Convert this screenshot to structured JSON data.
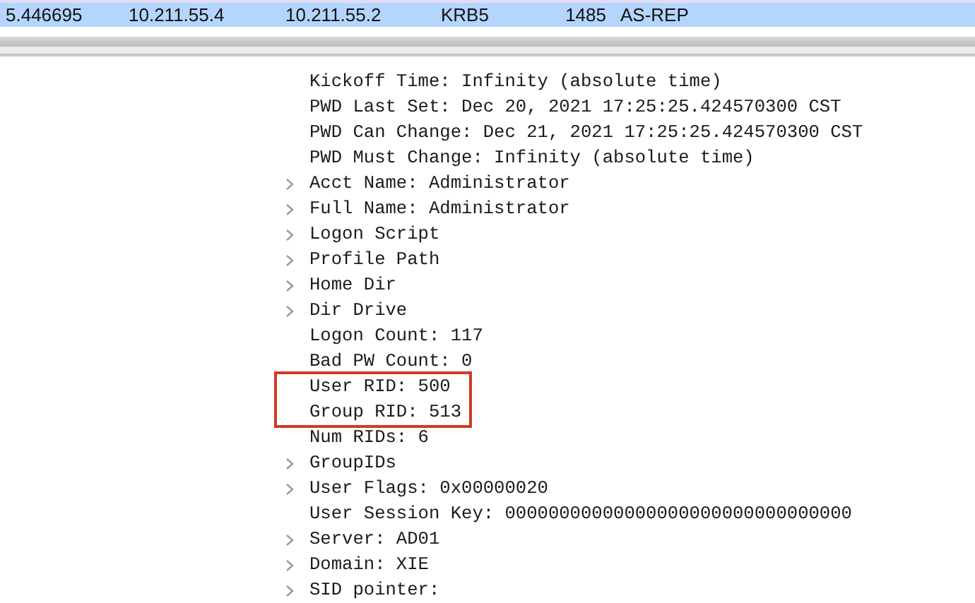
{
  "packet_row": {
    "selected": true,
    "cells": [
      "5.446695",
      "10.211.55.4",
      "10.211.55.2",
      "KRB5",
      "1485",
      "AS-REP"
    ]
  },
  "details": [
    {
      "text": "Kickoff Time: Infinity (absolute time)",
      "expandable": false,
      "highlighted": false
    },
    {
      "text": "PWD Last Set: Dec 20, 2021 17:25:25.424570300 CST",
      "expandable": false,
      "highlighted": false
    },
    {
      "text": "PWD Can Change: Dec 21, 2021 17:25:25.424570300 CST",
      "expandable": false,
      "highlighted": false
    },
    {
      "text": "PWD Must Change: Infinity (absolute time)",
      "expandable": false,
      "highlighted": false
    },
    {
      "text": "Acct Name: Administrator",
      "expandable": true,
      "highlighted": false
    },
    {
      "text": "Full Name: Administrator",
      "expandable": true,
      "highlighted": false
    },
    {
      "text": "Logon Script",
      "expandable": true,
      "highlighted": false
    },
    {
      "text": "Profile Path",
      "expandable": true,
      "highlighted": false
    },
    {
      "text": "Home Dir",
      "expandable": true,
      "highlighted": false
    },
    {
      "text": "Dir Drive",
      "expandable": true,
      "highlighted": false
    },
    {
      "text": "Logon Count: 117",
      "expandable": false,
      "highlighted": false
    },
    {
      "text": "Bad PW Count: 0",
      "expandable": false,
      "highlighted": false
    },
    {
      "text": "User RID: 500",
      "expandable": false,
      "highlighted": true
    },
    {
      "text": "Group RID: 513",
      "expandable": false,
      "highlighted": true
    },
    {
      "text": "Num RIDs: 6",
      "expandable": false,
      "highlighted": false
    },
    {
      "text": "GroupIDs",
      "expandable": true,
      "highlighted": false
    },
    {
      "text": "User Flags: 0x00000020",
      "expandable": true,
      "highlighted": false
    },
    {
      "text": "User Session Key: 00000000000000000000000000000000",
      "expandable": false,
      "highlighted": false
    },
    {
      "text": "Server: AD01",
      "expandable": true,
      "highlighted": false
    },
    {
      "text": "Domain: XIE",
      "expandable": true,
      "highlighted": false
    },
    {
      "text": "SID pointer:",
      "expandable": true,
      "highlighted": false
    }
  ]
}
